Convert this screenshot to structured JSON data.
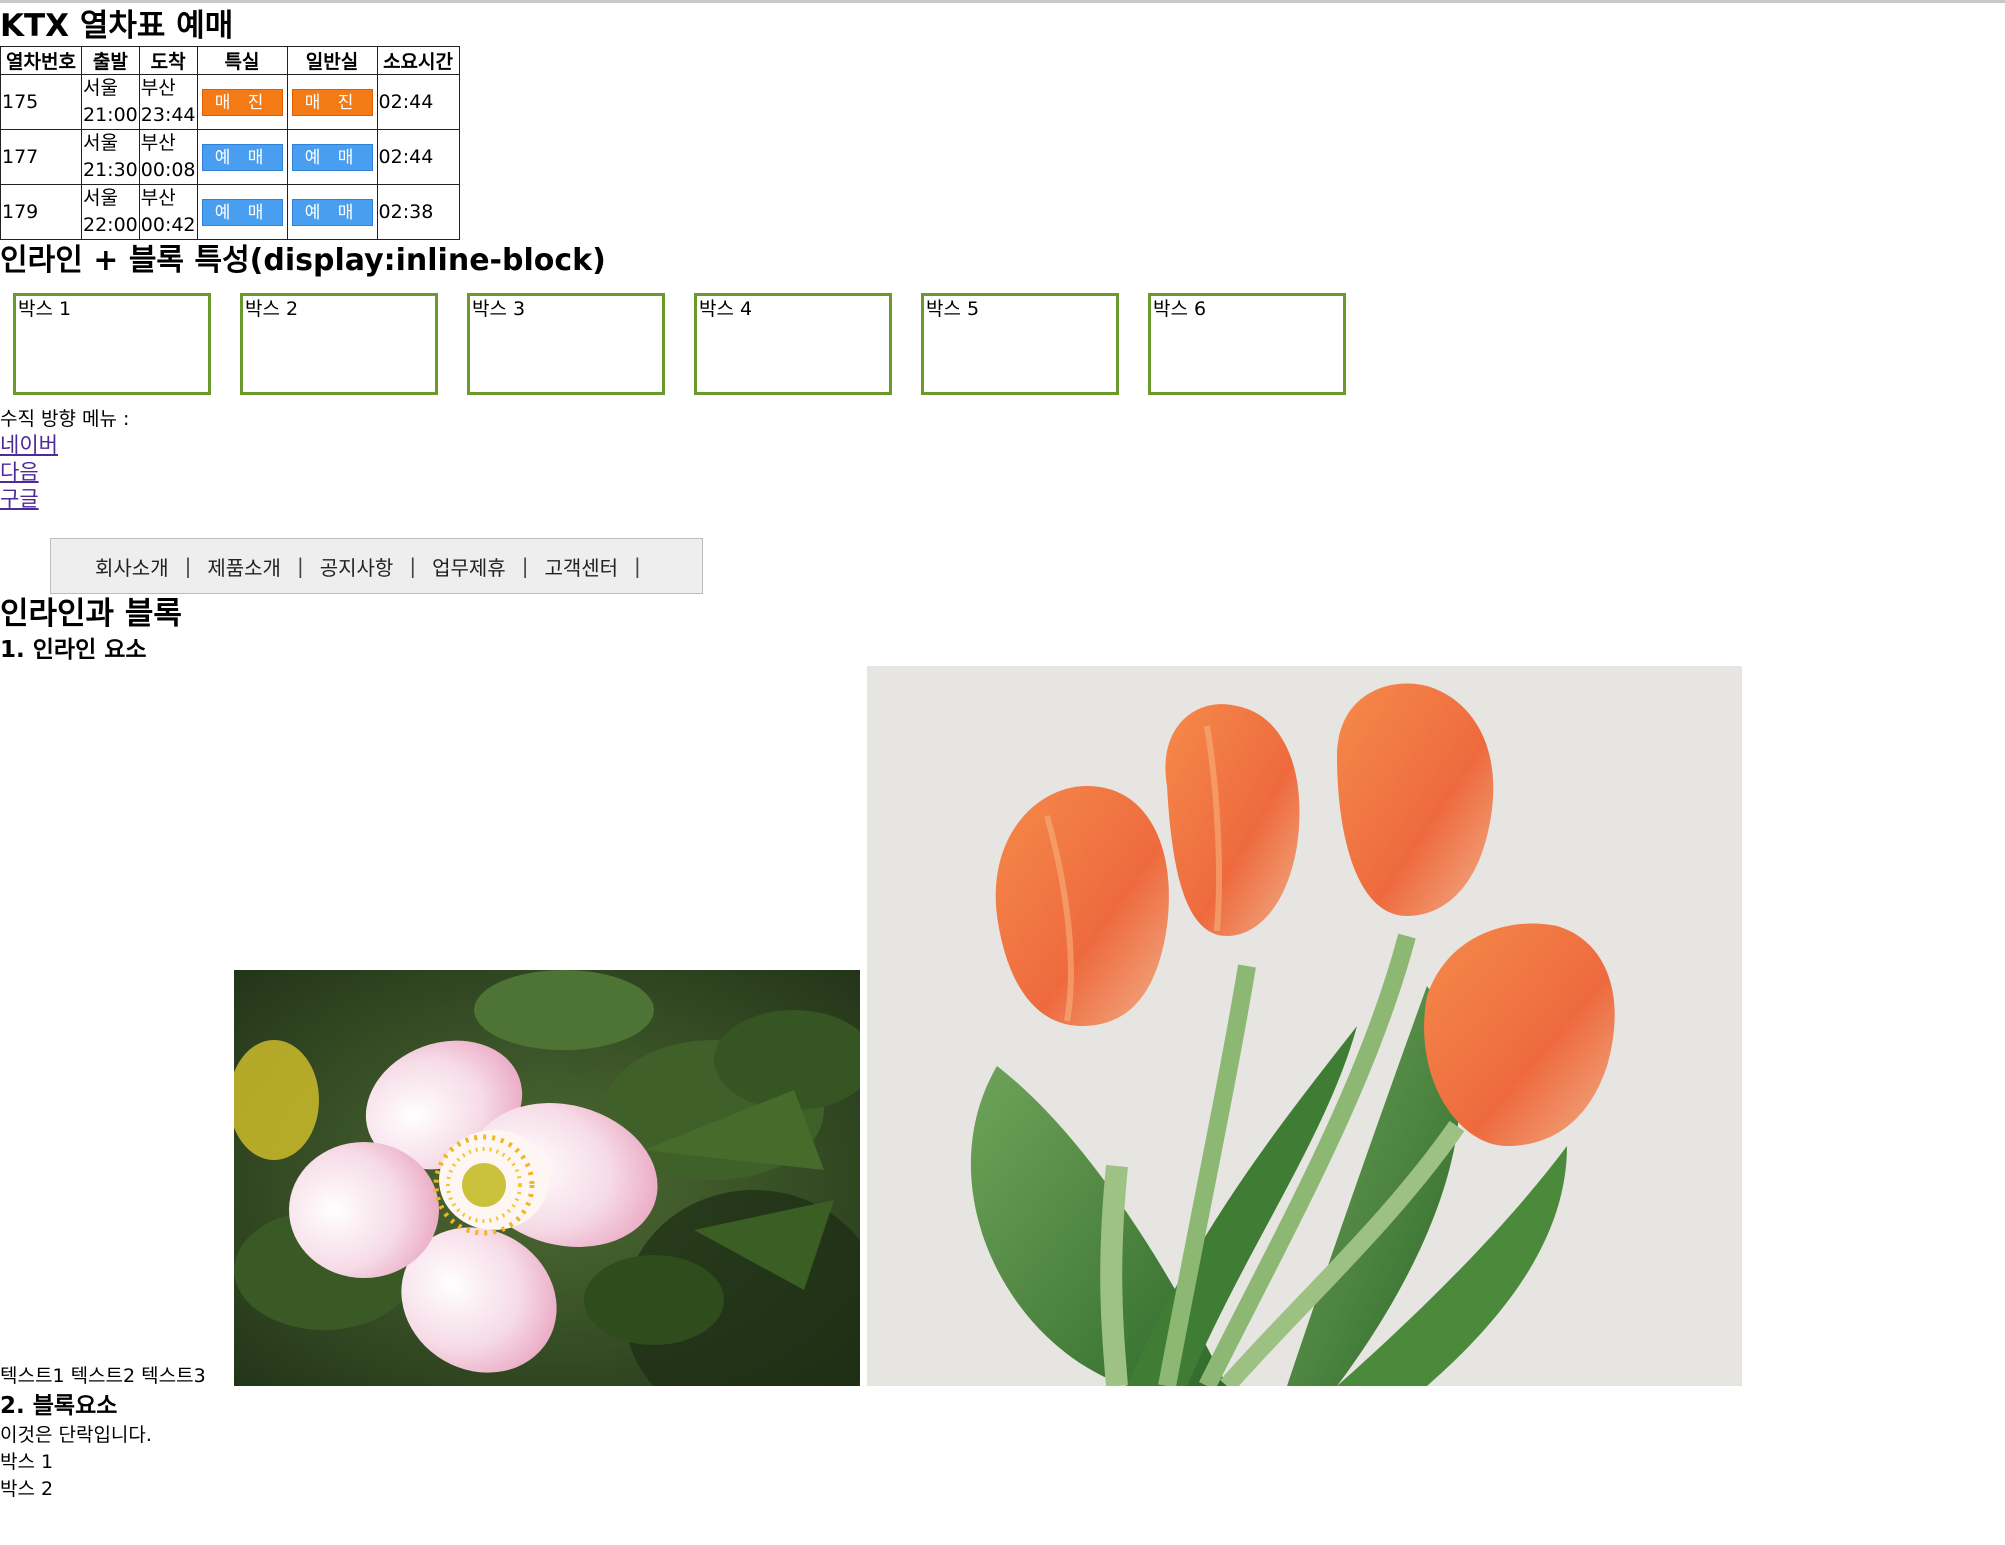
{
  "ktx": {
    "title": "KTX 열차표 예매",
    "headers": [
      "열차번호",
      "출발",
      "도착",
      "특실",
      "일반실",
      "소요시간"
    ],
    "rows": [
      {
        "train": "175",
        "from": "서울",
        "dep": "21:00",
        "to": "부산",
        "arr": "23:44",
        "special": "매 진",
        "general": "매 진",
        "duration": "02:44"
      },
      {
        "train": "177",
        "from": "서울",
        "dep": "21:30",
        "to": "부산",
        "arr": "00:08",
        "special": "예 매",
        "general": "예 매",
        "duration": "02:44"
      },
      {
        "train": "179",
        "from": "서울",
        "dep": "22:00",
        "to": "부산",
        "arr": "00:42",
        "special": "예 매",
        "general": "예 매",
        "duration": "02:38"
      }
    ],
    "colors": {
      "sold_out": "#f47a16",
      "booking": "#4a9ef0"
    }
  },
  "inline_block": {
    "heading": "인라인 + 블록 특성(display:inline-block)",
    "boxes": [
      "박스 1",
      "박스 2",
      "박스 3",
      "박스 4",
      "박스 5",
      "박스 6"
    ],
    "border_color": "#6a9a2a"
  },
  "vertical_menu": {
    "label": "수직 방향 메뉴 :",
    "links": [
      "네이버",
      "다음",
      "구글"
    ]
  },
  "horizontal_menu": {
    "items": [
      "회사소개",
      "제품소개",
      "공지사항",
      "업무제휴",
      "고객센터"
    ],
    "separator": "|"
  },
  "inline_and_block": {
    "heading": "인라인과 블록",
    "section1": "1. 인라인 요소",
    "texts": [
      "텍스트1",
      "텍스트2",
      "텍스트3"
    ],
    "section2": "2. 블록요소",
    "paragraph": "이것은 단락입니다.",
    "block_boxes": [
      "박스 1",
      "박스 2"
    ]
  }
}
